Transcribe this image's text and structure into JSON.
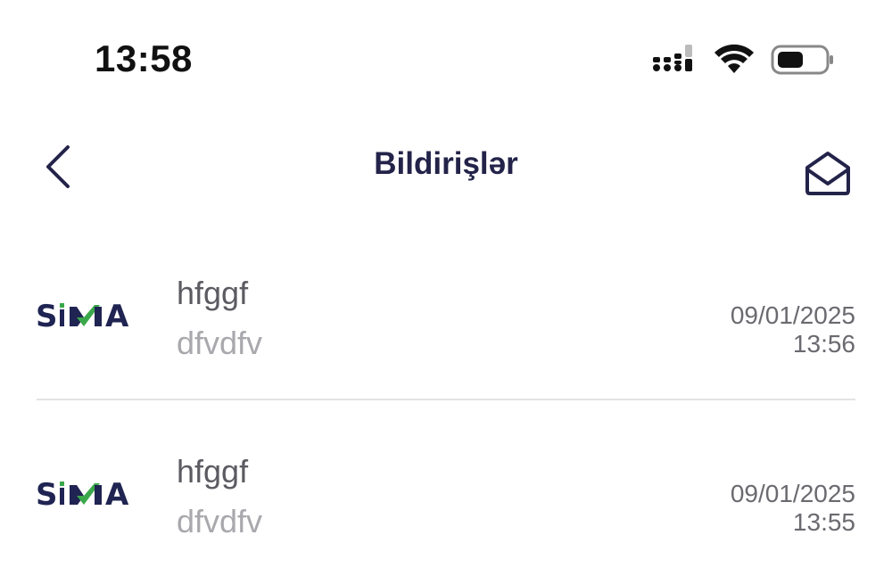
{
  "status_bar": {
    "time": "13:58",
    "icons": [
      "cellular-signal-icon",
      "wifi-icon",
      "battery-icon"
    ]
  },
  "header": {
    "back_icon": "chevron-left-icon",
    "title": "Bildirişlər",
    "mail_icon": "envelope-open-icon"
  },
  "colors": {
    "title": "#23234a",
    "brand_navy": "#1f2452",
    "brand_green": "#3aa84a",
    "subtitle_gray": "#a8a8ad",
    "divider": "#e3e3e6"
  },
  "notifications": [
    {
      "logo": "SIMA",
      "title": "hfggf",
      "body": "dfvdfv",
      "date": "09/01/2025",
      "time": "13:56"
    },
    {
      "logo": "SIMA",
      "title": "hfggf",
      "body": "dfvdfv",
      "date": "09/01/2025",
      "time": "13:55"
    }
  ]
}
